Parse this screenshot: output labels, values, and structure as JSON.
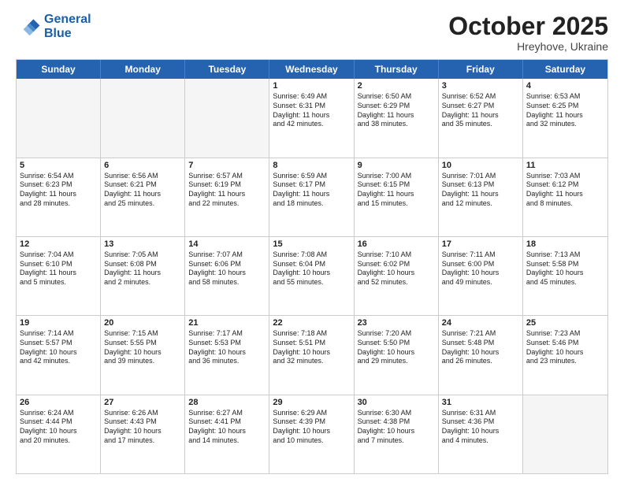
{
  "header": {
    "logo_line1": "General",
    "logo_line2": "Blue",
    "month": "October 2025",
    "location": "Hreyhove, Ukraine"
  },
  "weekdays": [
    "Sunday",
    "Monday",
    "Tuesday",
    "Wednesday",
    "Thursday",
    "Friday",
    "Saturday"
  ],
  "rows": [
    [
      {
        "day": "",
        "text": ""
      },
      {
        "day": "",
        "text": ""
      },
      {
        "day": "",
        "text": ""
      },
      {
        "day": "1",
        "text": "Sunrise: 6:49 AM\nSunset: 6:31 PM\nDaylight: 11 hours\nand 42 minutes."
      },
      {
        "day": "2",
        "text": "Sunrise: 6:50 AM\nSunset: 6:29 PM\nDaylight: 11 hours\nand 38 minutes."
      },
      {
        "day": "3",
        "text": "Sunrise: 6:52 AM\nSunset: 6:27 PM\nDaylight: 11 hours\nand 35 minutes."
      },
      {
        "day": "4",
        "text": "Sunrise: 6:53 AM\nSunset: 6:25 PM\nDaylight: 11 hours\nand 32 minutes."
      }
    ],
    [
      {
        "day": "5",
        "text": "Sunrise: 6:54 AM\nSunset: 6:23 PM\nDaylight: 11 hours\nand 28 minutes."
      },
      {
        "day": "6",
        "text": "Sunrise: 6:56 AM\nSunset: 6:21 PM\nDaylight: 11 hours\nand 25 minutes."
      },
      {
        "day": "7",
        "text": "Sunrise: 6:57 AM\nSunset: 6:19 PM\nDaylight: 11 hours\nand 22 minutes."
      },
      {
        "day": "8",
        "text": "Sunrise: 6:59 AM\nSunset: 6:17 PM\nDaylight: 11 hours\nand 18 minutes."
      },
      {
        "day": "9",
        "text": "Sunrise: 7:00 AM\nSunset: 6:15 PM\nDaylight: 11 hours\nand 15 minutes."
      },
      {
        "day": "10",
        "text": "Sunrise: 7:01 AM\nSunset: 6:13 PM\nDaylight: 11 hours\nand 12 minutes."
      },
      {
        "day": "11",
        "text": "Sunrise: 7:03 AM\nSunset: 6:12 PM\nDaylight: 11 hours\nand 8 minutes."
      }
    ],
    [
      {
        "day": "12",
        "text": "Sunrise: 7:04 AM\nSunset: 6:10 PM\nDaylight: 11 hours\nand 5 minutes."
      },
      {
        "day": "13",
        "text": "Sunrise: 7:05 AM\nSunset: 6:08 PM\nDaylight: 11 hours\nand 2 minutes."
      },
      {
        "day": "14",
        "text": "Sunrise: 7:07 AM\nSunset: 6:06 PM\nDaylight: 10 hours\nand 58 minutes."
      },
      {
        "day": "15",
        "text": "Sunrise: 7:08 AM\nSunset: 6:04 PM\nDaylight: 10 hours\nand 55 minutes."
      },
      {
        "day": "16",
        "text": "Sunrise: 7:10 AM\nSunset: 6:02 PM\nDaylight: 10 hours\nand 52 minutes."
      },
      {
        "day": "17",
        "text": "Sunrise: 7:11 AM\nSunset: 6:00 PM\nDaylight: 10 hours\nand 49 minutes."
      },
      {
        "day": "18",
        "text": "Sunrise: 7:13 AM\nSunset: 5:58 PM\nDaylight: 10 hours\nand 45 minutes."
      }
    ],
    [
      {
        "day": "19",
        "text": "Sunrise: 7:14 AM\nSunset: 5:57 PM\nDaylight: 10 hours\nand 42 minutes."
      },
      {
        "day": "20",
        "text": "Sunrise: 7:15 AM\nSunset: 5:55 PM\nDaylight: 10 hours\nand 39 minutes."
      },
      {
        "day": "21",
        "text": "Sunrise: 7:17 AM\nSunset: 5:53 PM\nDaylight: 10 hours\nand 36 minutes."
      },
      {
        "day": "22",
        "text": "Sunrise: 7:18 AM\nSunset: 5:51 PM\nDaylight: 10 hours\nand 32 minutes."
      },
      {
        "day": "23",
        "text": "Sunrise: 7:20 AM\nSunset: 5:50 PM\nDaylight: 10 hours\nand 29 minutes."
      },
      {
        "day": "24",
        "text": "Sunrise: 7:21 AM\nSunset: 5:48 PM\nDaylight: 10 hours\nand 26 minutes."
      },
      {
        "day": "25",
        "text": "Sunrise: 7:23 AM\nSunset: 5:46 PM\nDaylight: 10 hours\nand 23 minutes."
      }
    ],
    [
      {
        "day": "26",
        "text": "Sunrise: 6:24 AM\nSunset: 4:44 PM\nDaylight: 10 hours\nand 20 minutes."
      },
      {
        "day": "27",
        "text": "Sunrise: 6:26 AM\nSunset: 4:43 PM\nDaylight: 10 hours\nand 17 minutes."
      },
      {
        "day": "28",
        "text": "Sunrise: 6:27 AM\nSunset: 4:41 PM\nDaylight: 10 hours\nand 14 minutes."
      },
      {
        "day": "29",
        "text": "Sunrise: 6:29 AM\nSunset: 4:39 PM\nDaylight: 10 hours\nand 10 minutes."
      },
      {
        "day": "30",
        "text": "Sunrise: 6:30 AM\nSunset: 4:38 PM\nDaylight: 10 hours\nand 7 minutes."
      },
      {
        "day": "31",
        "text": "Sunrise: 6:31 AM\nSunset: 4:36 PM\nDaylight: 10 hours\nand 4 minutes."
      },
      {
        "day": "",
        "text": ""
      }
    ]
  ]
}
